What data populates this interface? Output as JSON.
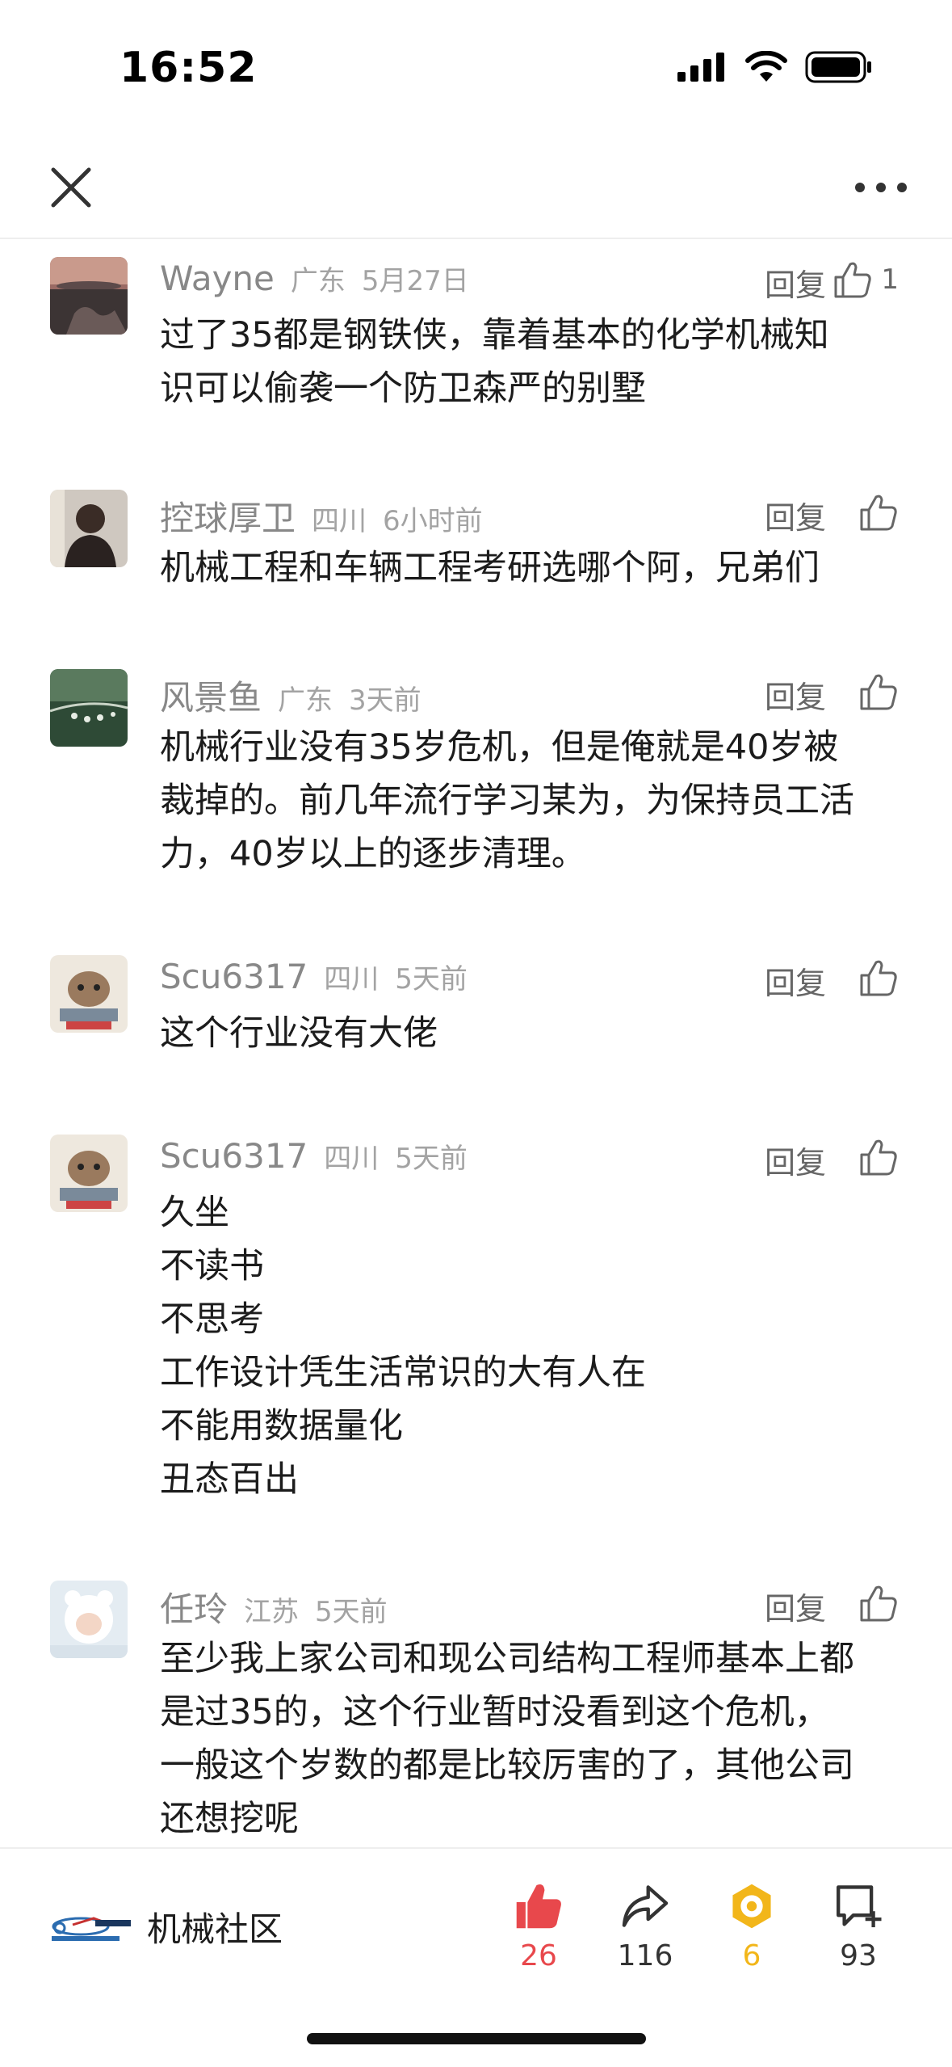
{
  "status_bar": {
    "time": "16:52"
  },
  "nav": {
    "close_icon": "close-icon",
    "more_icon": "more-dots-icon"
  },
  "comments": [
    {
      "name": "Wayne",
      "region": "广东",
      "time": "5月27日",
      "reply": "回复",
      "likes": "1",
      "lines": [
        "过了35都是钢铁侠，靠着基本的化学机械知",
        "识可以偷袭一个防卫森严的别墅"
      ]
    },
    {
      "name": "控球厚卫",
      "region": "四川",
      "time": "6小时前",
      "reply": "回复",
      "likes": "",
      "lines": [
        "机械工程和车辆工程考研选哪个阿，兄弟们"
      ]
    },
    {
      "name": "风景鱼",
      "region": "广东",
      "time": "3天前",
      "reply": "回复",
      "likes": "",
      "lines": [
        "机械行业没有35岁危机，但是俺就是40岁被",
        "裁掉的。前几年流行学习某为，为保持员工活",
        "力，40岁以上的逐步清理。"
      ]
    },
    {
      "name": "Scu6317",
      "region": "四川",
      "time": "5天前",
      "reply": "回复",
      "likes": "",
      "lines": [
        "这个行业没有大佬"
      ]
    },
    {
      "name": "Scu6317",
      "region": "四川",
      "time": "5天前",
      "reply": "回复",
      "likes": "",
      "lines": [
        "久坐",
        "不读书",
        "不思考",
        "工作设计凭生活常识的大有人在",
        "不能用数据量化",
        "丑态百出"
      ]
    },
    {
      "name": "任玲",
      "region": "江苏",
      "time": "5天前",
      "reply": "回复",
      "likes": "",
      "lines": [
        "至少我上家公司和现公司结构工程师基本上都",
        "是过35的，这个行业暂时没看到这个危机，",
        "一般这个岁数的都是比较厉害的了，其他公司",
        "还想挖呢"
      ]
    }
  ],
  "bottom_bar": {
    "brand_name": "机械社区",
    "brand_logo_text": "中国机械社区 www.cmiw.cn",
    "like_count": "26",
    "share_count": "116",
    "favorite_count": "6",
    "comment_count": "93",
    "colors": {
      "like": "#e8484c",
      "favorite": "#f2b61a",
      "default": "#333333"
    }
  }
}
